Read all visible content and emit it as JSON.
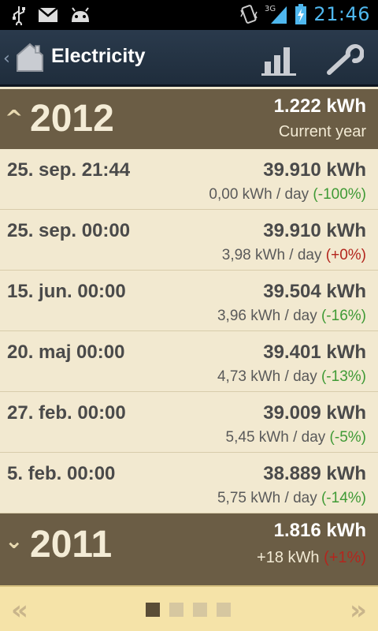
{
  "status_bar": {
    "time": "21:46",
    "network": "3G",
    "icons": [
      "usb-icon",
      "gmail-icon",
      "android-icon",
      "vibrate-icon",
      "signal-icon",
      "battery-charging-icon"
    ]
  },
  "action_bar": {
    "title": "Electricity",
    "back_icon": "chevron-left-icon",
    "home_icon": "home-icon",
    "actions": [
      "bar-chart-icon",
      "wrench-icon"
    ]
  },
  "years": [
    {
      "year": "2012",
      "expanded": true,
      "total": "1.222 kWh",
      "subtitle": "Current year",
      "readings": [
        {
          "date": "25. sep. 21:44",
          "value": "39.910 kWh",
          "rate": "0,00 kWh / day",
          "change": "(-100%)",
          "change_color": "#3f9a35"
        },
        {
          "date": "25. sep. 00:00",
          "value": "39.910 kWh",
          "rate": "3,98 kWh / day",
          "change": "(+0%)",
          "change_color": "#b3261e"
        },
        {
          "date": "15. jun. 00:00",
          "value": "39.504 kWh",
          "rate": "3,96 kWh / day",
          "change": "(-16%)",
          "change_color": "#3f9a35"
        },
        {
          "date": "20. maj 00:00",
          "value": "39.401 kWh",
          "rate": "4,73 kWh / day",
          "change": "(-13%)",
          "change_color": "#3f9a35"
        },
        {
          "date": "27. feb. 00:00",
          "value": "39.009 kWh",
          "rate": "5,45 kWh / day",
          "change": "(-5%)",
          "change_color": "#3f9a35"
        },
        {
          "date": "5. feb. 00:00",
          "value": "38.889 kWh",
          "rate": "5,75 kWh / day",
          "change": "(-14%)",
          "change_color": "#3f9a35"
        }
      ]
    },
    {
      "year": "2011",
      "expanded": false,
      "total": "1.816 kWh",
      "subtitle": "+18 kWh",
      "change": "(+1%)",
      "change_color": "#b3261e"
    }
  ],
  "pager": {
    "page_count": 4,
    "current_page": 1,
    "prev_icon": "double-chevron-left-icon",
    "next_icon": "double-chevron-right-icon"
  },
  "colors": {
    "year_header": "#6b5d45",
    "row_bg": "#f2e9d0",
    "action_bar": "#243446",
    "clock": "#4fb8ef",
    "positive": "#3f9a35",
    "negative": "#b3261e"
  }
}
